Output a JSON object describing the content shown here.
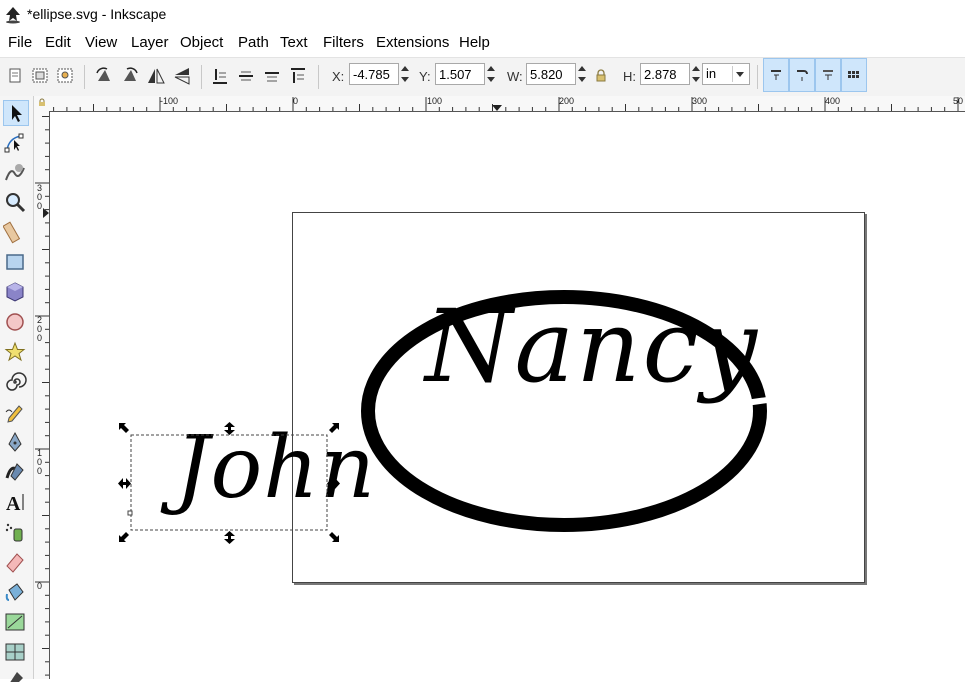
{
  "window": {
    "title": "*ellipse.svg - Inkscape",
    "app_icon": "inkscape-logo-icon"
  },
  "menu": [
    "File",
    "Edit",
    "View",
    "Layer",
    "Object",
    "Path",
    "Text",
    "Filters",
    "Extensions",
    "Help"
  ],
  "toolbar": {
    "buttons": [
      "select-all-icon",
      "select-all-layers-icon",
      "deselect-icon",
      "rotate-ccw-icon",
      "rotate-cw-icon",
      "flip-horizontal-icon",
      "flip-vertical-icon",
      "lower-to-bottom-icon",
      "lower-icon",
      "raise-icon",
      "raise-to-top-icon"
    ],
    "x_label": "X:",
    "x_value": "-4.785",
    "y_label": "Y:",
    "y_value": "1.507",
    "w_label": "W:",
    "w_value": "5.820",
    "h_label": "H:",
    "h_value": "2.878",
    "unit": "in",
    "lock_icon": "lock-icon",
    "snap_buttons": [
      "scale-stroke-icon",
      "scale-corners-icon",
      "scale-gradients-icon",
      "scale-patterns-icon"
    ]
  },
  "tools": [
    "selector-tool",
    "node-tool",
    "tweak-tool",
    "zoom-tool",
    "measure-tool",
    "rectangle-tool",
    "3d-box-tool",
    "ellipse-tool",
    "star-tool",
    "spiral-tool",
    "pencil-tool",
    "pen-tool",
    "calligraphy-tool",
    "text-tool",
    "spray-tool",
    "eraser-tool",
    "paint-bucket-tool",
    "gradient-tool",
    "mesh-tool",
    "dropper-tool"
  ],
  "rulers": {
    "horizontal": [
      "-100",
      "0",
      "100",
      "200",
      "300",
      "400",
      "50"
    ],
    "vertical": [
      "300",
      "200",
      "100",
      "0"
    ]
  },
  "canvas": {
    "text_selected": "John",
    "text_ellipse": "Nancy"
  }
}
